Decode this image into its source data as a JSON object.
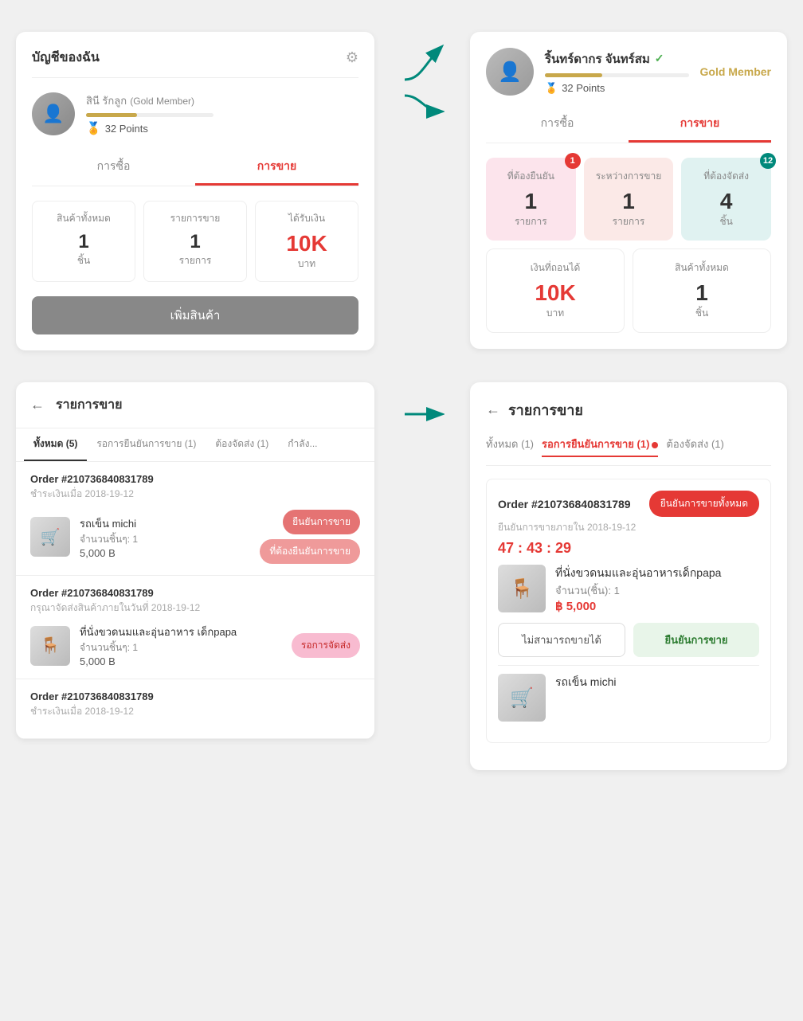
{
  "top_left_card": {
    "title": "บัญชีของฉัน",
    "gear_icon": "⚙",
    "user_name": "สินี รักลูก",
    "user_member": "(Gold Member)",
    "points": "32 Points",
    "medal": "🏅",
    "tabs": [
      {
        "label": "การซื้อ",
        "active": false
      },
      {
        "label": "การขาย",
        "active": true
      }
    ],
    "stats": [
      {
        "label": "สินค้าทั้งหมด",
        "value": "1",
        "unit": "ชิ้น"
      },
      {
        "label": "รายการขาย",
        "value": "1",
        "unit": "รายการ"
      },
      {
        "label": "ได้รับเงิน",
        "value": "10K",
        "unit": "บาท"
      }
    ],
    "add_product_btn": "เพิ่มสินค้า"
  },
  "top_right_card": {
    "user_name": "ริ้นทร์ดากร จันทร์สม",
    "verified": "✓",
    "gold_member": "Gold Member",
    "points": "32 Points",
    "medal": "🏅",
    "tabs": [
      {
        "label": "การซื้อ",
        "active": false
      },
      {
        "label": "การขาย",
        "active": true
      }
    ],
    "selling_stats": [
      {
        "label": "ที่ต้องยืนยัน",
        "value": "1",
        "unit": "รายการ",
        "color": "pink",
        "badge": "1"
      },
      {
        "label": "ระหว่างการขาย",
        "value": "1",
        "unit": "รายการ",
        "color": "peach",
        "badge": null
      },
      {
        "label": "ที่ต้องจัดส่ง",
        "value": "4",
        "unit": "ชิ้น",
        "color": "teal",
        "badge": "12"
      }
    ],
    "bottom_stats": [
      {
        "label": "เงินที่ถอนได้",
        "value": "10K",
        "unit": "บาท"
      },
      {
        "label": "สินค้าทั้งหมด",
        "value": "1",
        "unit": "ชิ้น"
      }
    ]
  },
  "bottom_left_card": {
    "back_icon": "←",
    "title": "รายการขาย",
    "tabs": [
      {
        "label": "ทั้งหมด (5)",
        "active": true
      },
      {
        "label": "รอการยืนยันการขาย (1)",
        "active": false
      },
      {
        "label": "ต้องจัดส่ง (1)",
        "active": false
      },
      {
        "label": "กำลัง...",
        "active": false
      }
    ],
    "orders": [
      {
        "id": "Order #210736840831789",
        "date": "ชำระเงินเมื่อ 2018-19-12",
        "items": [
          {
            "name": "รถเข็น michi",
            "qty": "จำนวนชิ้นๆ: 1",
            "price": "5,000 B",
            "action": "ยืนยันการขาย",
            "action2": "ที่ต้องยืนยันการขาย"
          }
        ]
      },
      {
        "id": "Order #210736840831789",
        "date": "กรุณาจัดส่งสินค้าภายในวันที่ 2018-19-12",
        "items": [
          {
            "name": "ที่นั่งขวดนมและอุ่นอาหาร เด็กpapa",
            "qty": "จำนวนชิ้นๆ: 1",
            "price": "5,000 B",
            "action": "รอการจัดส่ง",
            "action2": null
          }
        ]
      },
      {
        "id": "Order #210736840831789",
        "date": "ชำระเงินเมื่อ 2018-19-12",
        "items": []
      }
    ]
  },
  "bottom_right_card": {
    "back_icon": "←",
    "title": "รายการขาย",
    "tabs": [
      {
        "label": "ทั้งหมด (1)",
        "active": false
      },
      {
        "label": "รอการยืนยันการขาย (1)",
        "active": true,
        "dot": true
      },
      {
        "label": "ต้องจัดส่ง (1)",
        "active": false
      }
    ],
    "order": {
      "id": "Order #210736840831789",
      "date": "ยืนยันการขายภายใน 2018-19-12",
      "countdown": "47 : 43 : 29",
      "confirm_all_btn": "ยืนยันการขายทั้งหมด",
      "items": [
        {
          "name": "ที่นั่งขวดนมและอุ่นอาหารเด็กpapa",
          "qty": "จำนวน(ชิ้น): 1",
          "price": "฿ 5,000",
          "img_icon": "🪑"
        }
      ],
      "action_cannot": "ไม่สามารถขายได้",
      "action_confirm": "ยืนยันการขาย"
    },
    "next_item": {
      "name": "รถเข็น michi",
      "img_icon": "🛒"
    }
  }
}
